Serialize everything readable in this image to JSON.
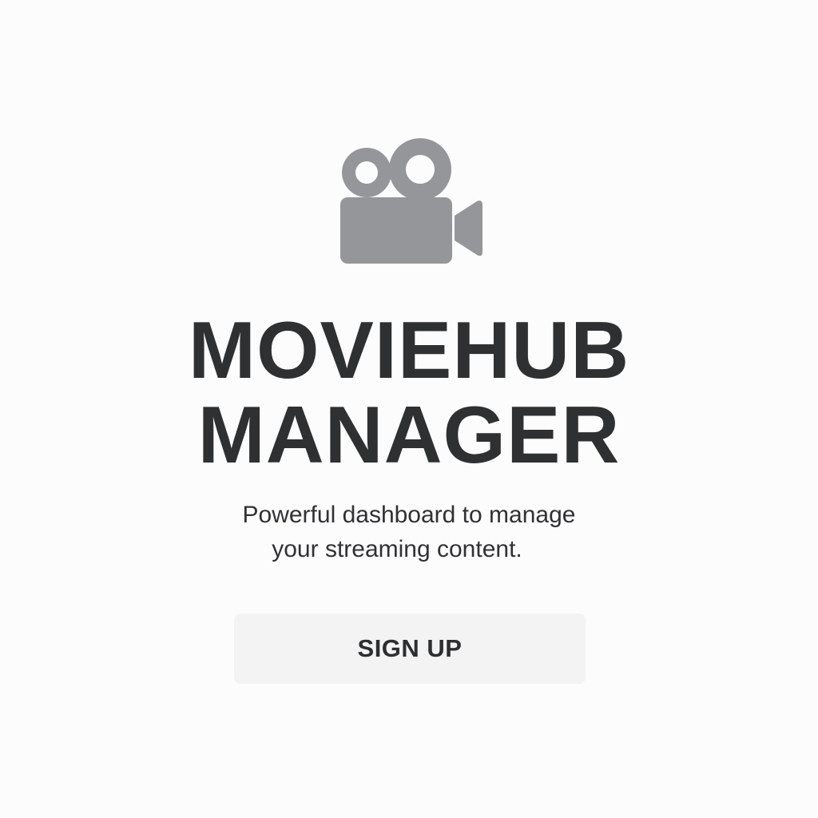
{
  "hero": {
    "logo_icon": "movie-camera-icon",
    "logo_color": "#95969a",
    "title_line_1": "MOVIEHUB",
    "title_line_2": "MANAGER",
    "subtitle_line_1": "Powerful dashboard to manage",
    "subtitle_line_2": "your streaming content."
  },
  "actions": {
    "signup_label": "SIGN UP"
  },
  "colors": {
    "background": "#fcfcfc",
    "text": "#2f3032",
    "button_bg": "#f3f3f3"
  }
}
